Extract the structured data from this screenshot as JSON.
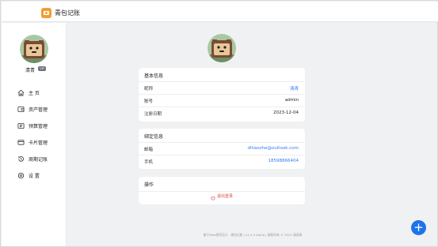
{
  "app": {
    "title": "青包记账",
    "brand_color": "#f39c33"
  },
  "sidebar": {
    "user_name": "清青",
    "badge": "VIP",
    "items": [
      {
        "icon": "home-icon",
        "label": "主 页"
      },
      {
        "icon": "wallet-icon",
        "label": "资产管理"
      },
      {
        "icon": "budget-icon",
        "label": "预算管理"
      },
      {
        "icon": "card-icon",
        "label": "卡片管理"
      },
      {
        "icon": "history-icon",
        "label": "周期记账"
      },
      {
        "icon": "settings-icon",
        "label": "设 置"
      }
    ]
  },
  "basic_info": {
    "title": "基本信息",
    "rows": [
      {
        "label": "昵称",
        "value": "清青"
      },
      {
        "label": "账号",
        "value": "admin"
      },
      {
        "label": "注册日期",
        "value": "2023-12-04"
      }
    ]
  },
  "binding_info": {
    "title": "绑定信息",
    "rows": [
      {
        "label": "邮箱",
        "value": "dlhaozhe@outlook.com"
      },
      {
        "label": "手机",
        "value": "18598866404"
      }
    ]
  },
  "operations": {
    "title": "操作",
    "logout_label": "退出登录"
  },
  "footer": {
    "text": "基于Web程序设计 · 青包记账 | v1.0.0 Alpha | 版权所有 © 2023 清语青"
  },
  "colors": {
    "link": "#2f7cf6",
    "danger": "#e34949",
    "fab": "#1e73e8"
  }
}
